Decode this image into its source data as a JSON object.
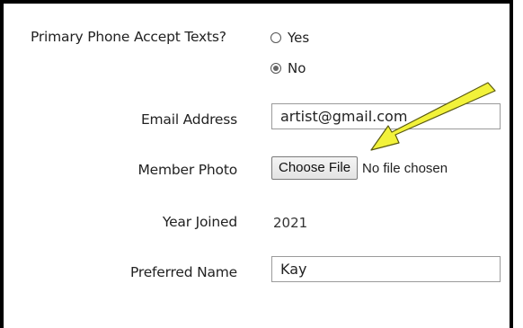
{
  "form": {
    "texts_label": "Primary Phone Accept Texts?",
    "texts_options": [
      {
        "label": "Yes",
        "checked": false
      },
      {
        "label": "No",
        "checked": true
      }
    ],
    "email_label": "Email Address",
    "email_value": "artist@gmail.com",
    "photo_label": "Member Photo",
    "photo_button": "Choose File",
    "photo_status": "No file chosen",
    "year_label": "Year Joined",
    "year_value": "2021",
    "preferred_label": "Preferred Name",
    "preferred_value": "Kay"
  },
  "annotation": {
    "arrow_color": "#f2f23a",
    "arrow_outline": "#5a5a10",
    "arrow_icon": "pointer-arrow-icon"
  }
}
